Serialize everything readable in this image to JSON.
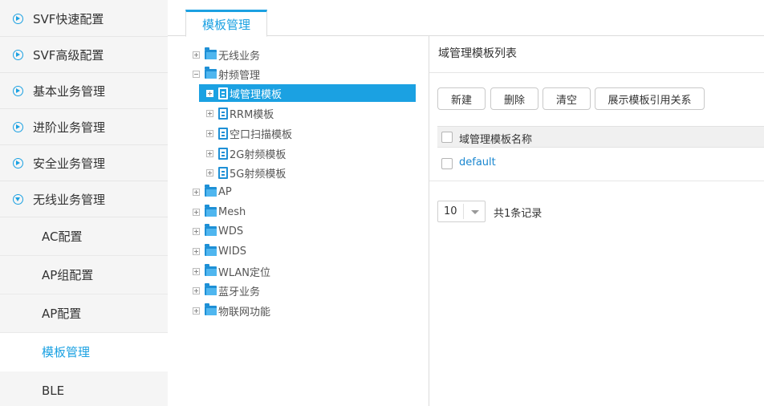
{
  "sidebar": {
    "items": [
      {
        "label": "SVF快速配置"
      },
      {
        "label": "SVF高级配置"
      },
      {
        "label": "基本业务管理"
      },
      {
        "label": "进阶业务管理"
      },
      {
        "label": "安全业务管理"
      },
      {
        "label": "无线业务管理"
      }
    ],
    "sub_items": [
      {
        "label": "AC配置"
      },
      {
        "label": "AP组配置"
      },
      {
        "label": "AP配置"
      },
      {
        "label": "模板管理"
      },
      {
        "label": "BLE"
      }
    ],
    "active_sub": "模板管理",
    "accent": "#1ba1e2"
  },
  "tabs": [
    {
      "label": "模板管理"
    }
  ],
  "tree": {
    "nodes": [
      {
        "label": "无线业务"
      },
      {
        "label": "射频管理"
      },
      {
        "label": "域管理模板"
      },
      {
        "label": "RRM模板"
      },
      {
        "label": "空口扫描模板"
      },
      {
        "label": "2G射频模板"
      },
      {
        "label": "5G射频模板"
      },
      {
        "label": "AP"
      },
      {
        "label": "Mesh"
      },
      {
        "label": "WDS"
      },
      {
        "label": "WIDS"
      },
      {
        "label": "WLAN定位"
      },
      {
        "label": "蓝牙业务"
      },
      {
        "label": "物联网功能"
      }
    ],
    "selected": "域管理模板"
  },
  "panel": {
    "title": "域管理模板列表",
    "buttons": {
      "new": "新建",
      "delete": "删除",
      "clear": "清空",
      "show_refs": "展示模板引用关系"
    },
    "table": {
      "header": "域管理模板名称",
      "rows": [
        {
          "name": "default"
        }
      ]
    },
    "pagination": {
      "page_size": "10",
      "total": "共1条记录"
    }
  }
}
